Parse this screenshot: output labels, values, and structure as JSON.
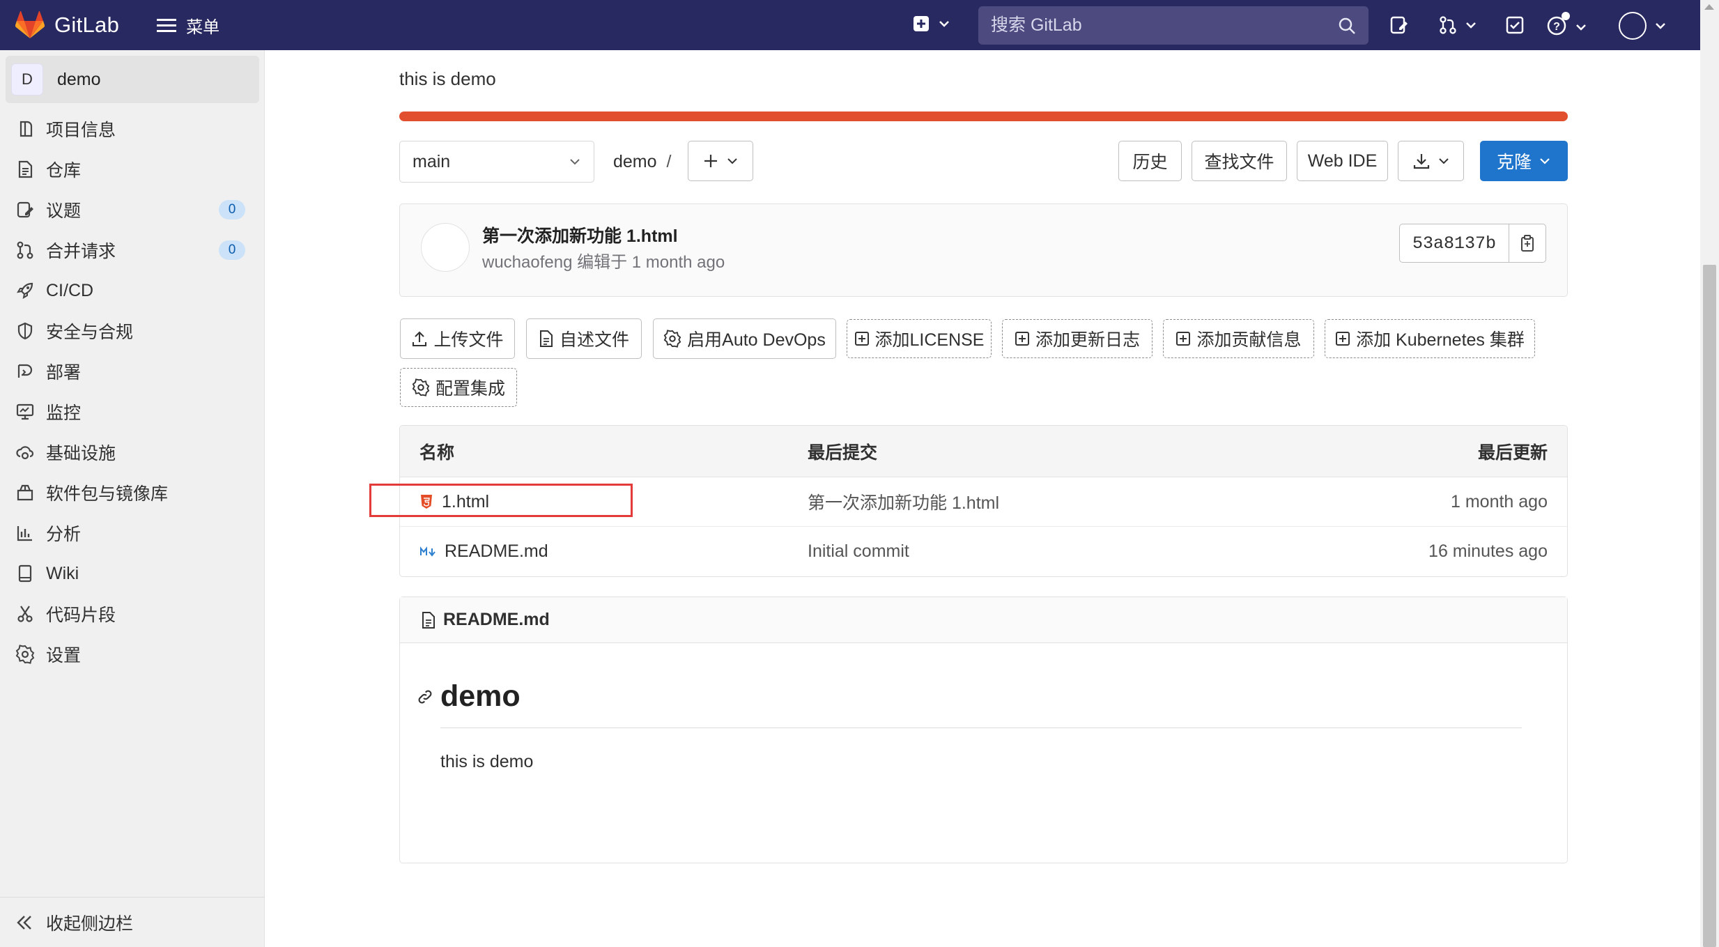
{
  "navbar": {
    "brand": "GitLab",
    "menu_label": "菜单",
    "search_placeholder": "搜索 GitLab"
  },
  "sidebar": {
    "project_initial": "D",
    "project_name": "demo",
    "items": [
      {
        "label": "项目信息",
        "icon": "info-icon"
      },
      {
        "label": "仓库",
        "icon": "document-icon"
      },
      {
        "label": "议题",
        "icon": "issues-icon",
        "count": "0"
      },
      {
        "label": "合并请求",
        "icon": "merge-request-icon",
        "count": "0"
      },
      {
        "label": "CI/CD",
        "icon": "rocket-icon"
      },
      {
        "label": "安全与合规",
        "icon": "shield-icon"
      },
      {
        "label": "部署",
        "icon": "deploy-icon"
      },
      {
        "label": "监控",
        "icon": "monitor-icon"
      },
      {
        "label": "基础设施",
        "icon": "cloud-gear-icon"
      },
      {
        "label": "软件包与镜像库",
        "icon": "package-icon"
      },
      {
        "label": "分析",
        "icon": "chart-icon"
      },
      {
        "label": "Wiki",
        "icon": "book-icon"
      },
      {
        "label": "代码片段",
        "icon": "snippet-icon"
      },
      {
        "label": "设置",
        "icon": "settings-icon"
      }
    ],
    "collapse_label": "收起侧边栏"
  },
  "project": {
    "description": "this is demo",
    "language_color": "#e24f2e"
  },
  "toolbar": {
    "branch": "main",
    "path": "demo",
    "path_sep": "/",
    "history": "历史",
    "find_file": "查找文件",
    "web_ide": "Web IDE",
    "clone": "克隆"
  },
  "last_commit": {
    "title": "第一次添加新功能 1.html",
    "meta": "wuchaofeng 编辑于 1 month ago",
    "sha": "53a8137b"
  },
  "actions": [
    {
      "label": "上传文件",
      "icon": "upload-icon"
    },
    {
      "label": "自述文件",
      "icon": "document-icon"
    },
    {
      "label": "启用Auto DevOps",
      "icon": "settings-icon"
    },
    {
      "label": "添加LICENSE",
      "icon": "plus-square-icon"
    },
    {
      "label": "添加更新日志",
      "icon": "plus-square-icon"
    },
    {
      "label": "添加贡献信息",
      "icon": "plus-square-icon"
    },
    {
      "label": "添加 Kubernetes 集群",
      "icon": "plus-square-icon"
    },
    {
      "label": "配置集成",
      "icon": "settings-icon"
    }
  ],
  "file_tree": {
    "headers": [
      "名称",
      "最后提交",
      "最后更新"
    ],
    "rows": [
      {
        "name": "1.html",
        "icon": "html5-icon",
        "commit": "第一次添加新功能 1.html",
        "updated": "1 month ago"
      },
      {
        "name": "README.md",
        "icon": "markdown-icon",
        "commit": "Initial commit",
        "updated": "16 minutes ago"
      }
    ]
  },
  "readme": {
    "filename": "README.md",
    "heading": "demo",
    "body": "this is demo"
  },
  "colors": {
    "navbar": "#292961",
    "primary": "#1f75cb",
    "highlight": "#e33a3a"
  }
}
